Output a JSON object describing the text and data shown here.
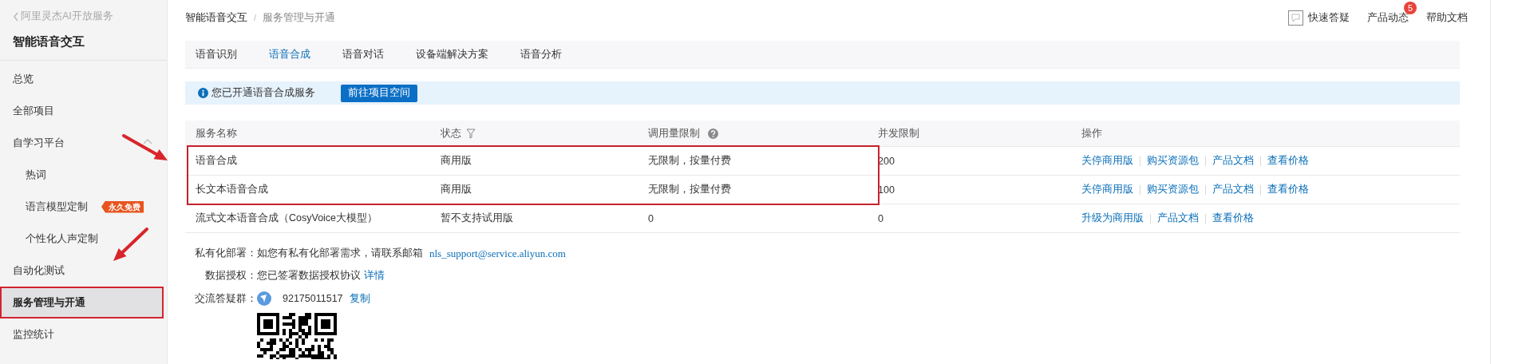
{
  "sidebar": {
    "back_link": "阿里灵杰AI开放服务",
    "title": "智能语音交互",
    "items": [
      {
        "label": "总览",
        "selected": false,
        "highlighted": false
      },
      {
        "label": "全部项目",
        "selected": false,
        "highlighted": false
      },
      {
        "label": "自学习平台",
        "selected": false,
        "highlighted": false,
        "expanded": true,
        "children": [
          {
            "label": "热词",
            "selected": false
          },
          {
            "label": "语言模型定制",
            "selected": false,
            "badge": "永久免费"
          },
          {
            "label": "个性化人声定制",
            "selected": false
          }
        ]
      },
      {
        "label": "自动化测试",
        "selected": false,
        "highlighted": false
      },
      {
        "label": "服务管理与开通",
        "selected": true,
        "highlighted": true
      },
      {
        "label": "监控统计",
        "selected": false,
        "highlighted": false
      }
    ]
  },
  "breadcrumb": {
    "items": [
      "智能语音交互",
      "服务管理与开通"
    ],
    "separator": "/"
  },
  "header_links": [
    {
      "kind": "icon",
      "label": "快速答疑"
    },
    {
      "kind": "badge",
      "label": "产品动态",
      "badge": "5"
    },
    {
      "kind": "plain",
      "label": "帮助文档"
    }
  ],
  "tabs": [
    {
      "label": "语音识别",
      "selected": false
    },
    {
      "label": "语音合成",
      "selected": true
    },
    {
      "label": "语音对话",
      "selected": false
    },
    {
      "label": "设备端解决方案",
      "selected": false
    },
    {
      "label": "语音分析",
      "selected": false
    }
  ],
  "notice": {
    "text": "您已开通语音合成服务",
    "button": "前往项目空间"
  },
  "table": {
    "columns": [
      {
        "label": "服务名称",
        "kind": "plain"
      },
      {
        "label": "状态",
        "kind": "filter"
      },
      {
        "label": "调用量限制",
        "kind": "help"
      },
      {
        "label": "并发限制",
        "kind": "plain"
      },
      {
        "label": "操作",
        "kind": "plain"
      }
    ],
    "rows": [
      {
        "name": "语音合成",
        "status": "商用版",
        "limit": "无限制，按量付费",
        "concurrency": "200",
        "actions": [
          "关停商用版",
          "购买资源包",
          "产品文档",
          "查看价格"
        ],
        "highlighted": true
      },
      {
        "name": "长文本语音合成",
        "status": "商用版",
        "limit": "无限制，按量付费",
        "concurrency": "100",
        "actions": [
          "关停商用版",
          "购买资源包",
          "产品文档",
          "查看价格"
        ],
        "highlighted": true
      },
      {
        "name": "流式文本语音合成（CosyVoice大模型）",
        "status": "暂不支持试用版",
        "limit": "0",
        "concurrency": "0",
        "actions": [
          "升级为商用版",
          "产品文档",
          "查看价格"
        ],
        "highlighted": false
      }
    ]
  },
  "info": [
    {
      "kind": "email",
      "label": "私有化部署：",
      "text": "如您有私有化部署需求，请联系邮箱",
      "link": "nls_support@service.aliyun.com"
    },
    {
      "kind": "link",
      "label": "数据授权：",
      "text": "您已签署数据授权协议",
      "link": "详情"
    },
    {
      "kind": "group",
      "label": "交流答疑群：",
      "text": "92175011517",
      "link": "复制"
    }
  ]
}
